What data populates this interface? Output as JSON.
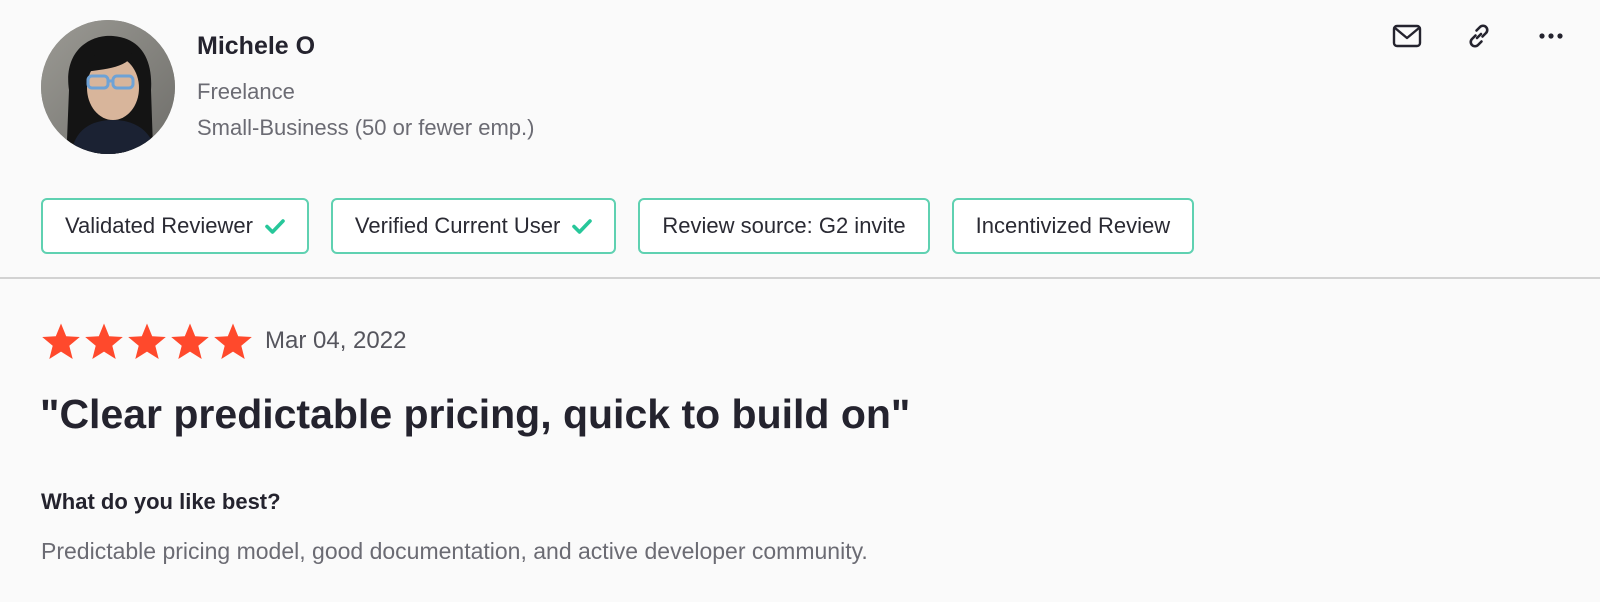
{
  "reviewer": {
    "name": "Michele O",
    "title": "Freelance",
    "company_size": "Small-Business (50 or fewer emp.)"
  },
  "actions": [
    {
      "icon": "mail-icon"
    },
    {
      "icon": "link-icon"
    },
    {
      "icon": "more-icon"
    }
  ],
  "badges": [
    {
      "label": "Validated Reviewer",
      "checked": true
    },
    {
      "label": "Verified Current User",
      "checked": true
    },
    {
      "label": "Review source: G2 invite",
      "checked": false
    },
    {
      "label": "Incentivized Review",
      "checked": false
    }
  ],
  "review": {
    "rating": 5,
    "max_rating": 5,
    "date": "Mar 04, 2022",
    "title": "\"Clear predictable pricing, quick to build on\"",
    "question": "What do you like best?",
    "answer": "Predictable pricing model, good documentation, and active developer community."
  },
  "colors": {
    "star": "#ff492c",
    "badge_border": "#5fd1b1",
    "check": "#27c79a",
    "text_dark": "#24232e",
    "text_muted": "#6b6b73"
  }
}
